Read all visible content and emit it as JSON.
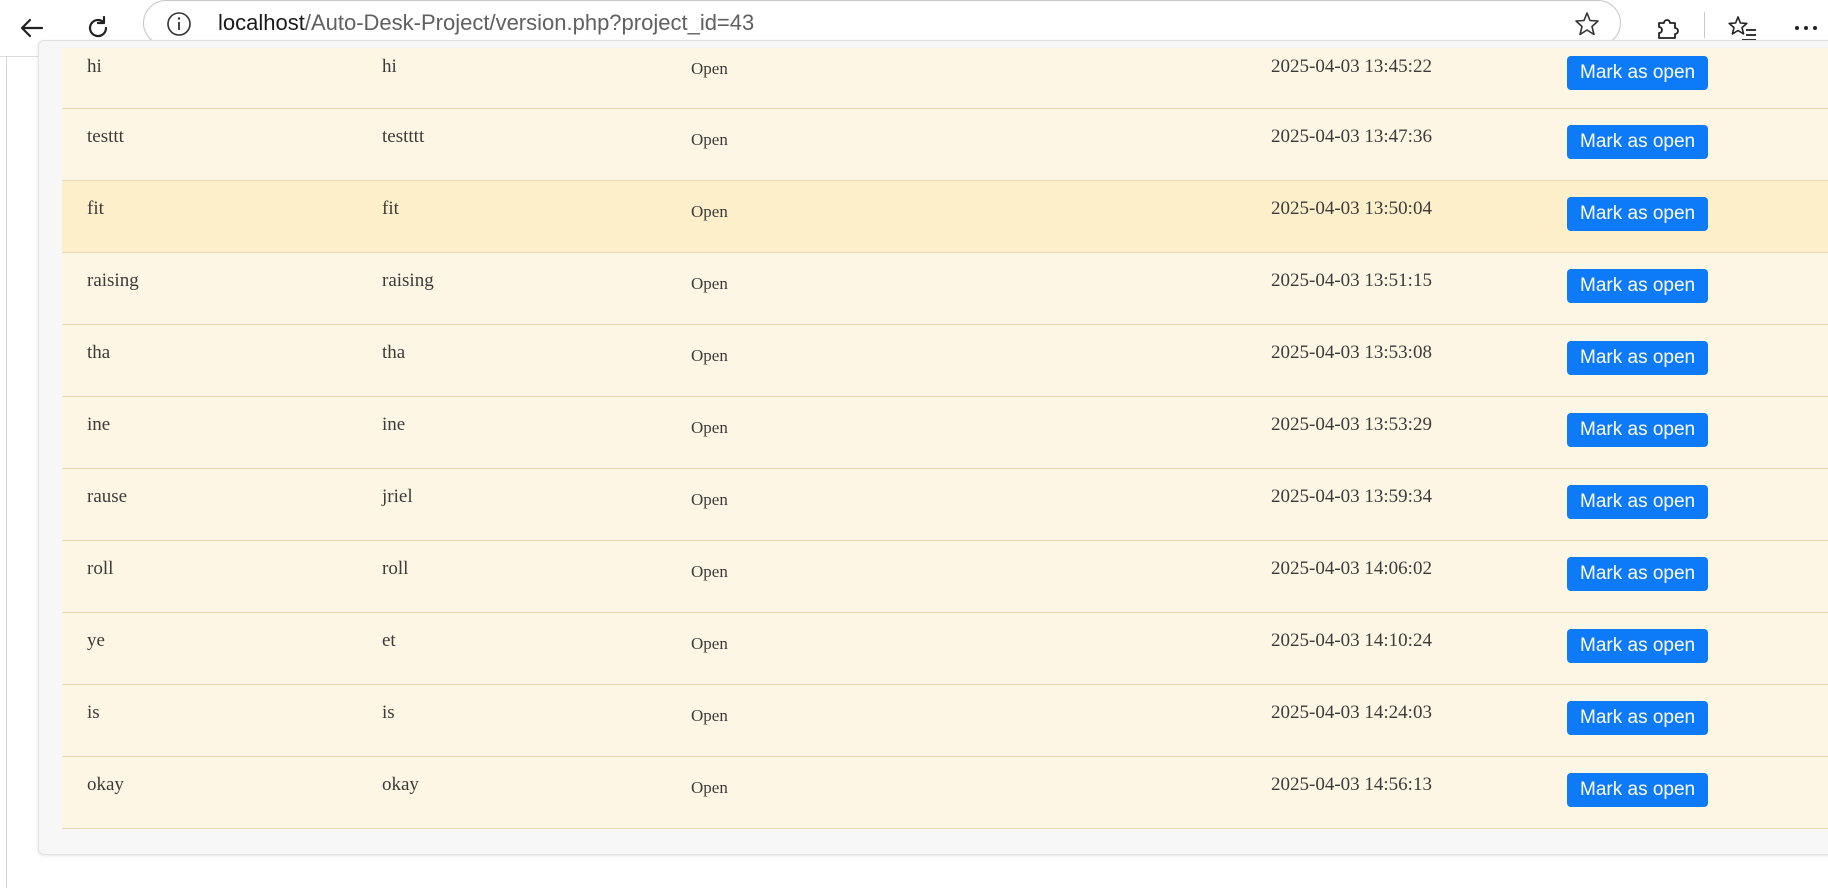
{
  "browser": {
    "url_host": "localhost",
    "url_path": "/Auto-Desk-Project/version.php?project_id=43",
    "icons": {
      "back": "back-arrow-icon",
      "reload": "reload-icon",
      "info": "info-icon",
      "favorite": "star-icon",
      "extensions": "puzzle-icon",
      "favorites": "favorites-list-icon",
      "more": "more-dots-icon"
    }
  },
  "table": {
    "rows": [
      {
        "c1": "hi",
        "c2": "hi",
        "status": "Open",
        "date": "2025-04-03 13:45:22",
        "button": "Mark as open"
      },
      {
        "c1": "testtt",
        "c2": "testttt",
        "status": "Open",
        "date": "2025-04-03 13:47:36",
        "button": "Mark as open"
      },
      {
        "c1": "fit",
        "c2": "fit",
        "status": "Open",
        "date": "2025-04-03 13:50:04",
        "button": "Mark as open"
      },
      {
        "c1": "raising",
        "c2": "raising",
        "status": "Open",
        "date": "2025-04-03 13:51:15",
        "button": "Mark as open"
      },
      {
        "c1": "tha",
        "c2": "tha",
        "status": "Open",
        "date": "2025-04-03 13:53:08",
        "button": "Mark as open"
      },
      {
        "c1": "ine",
        "c2": "ine",
        "status": "Open",
        "date": "2025-04-03 13:53:29",
        "button": "Mark as open"
      },
      {
        "c1": "rause",
        "c2": "jriel",
        "status": "Open",
        "date": "2025-04-03 13:59:34",
        "button": "Mark as open"
      },
      {
        "c1": "roll",
        "c2": "roll",
        "status": "Open",
        "date": "2025-04-03 14:06:02",
        "button": "Mark as open"
      },
      {
        "c1": "ye",
        "c2": "et",
        "status": "Open",
        "date": "2025-04-03 14:10:24",
        "button": "Mark as open"
      },
      {
        "c1": "is",
        "c2": "is",
        "status": "Open",
        "date": "2025-04-03 14:24:03",
        "button": "Mark as open"
      },
      {
        "c1": "okay",
        "c2": "okay",
        "status": "Open",
        "date": "2025-04-03 14:56:13",
        "button": "Mark as open"
      }
    ]
  },
  "colors": {
    "row_bg": "#fef6e4",
    "row_hover_bg": "#feefcb",
    "button_bg": "#0d7af7"
  }
}
